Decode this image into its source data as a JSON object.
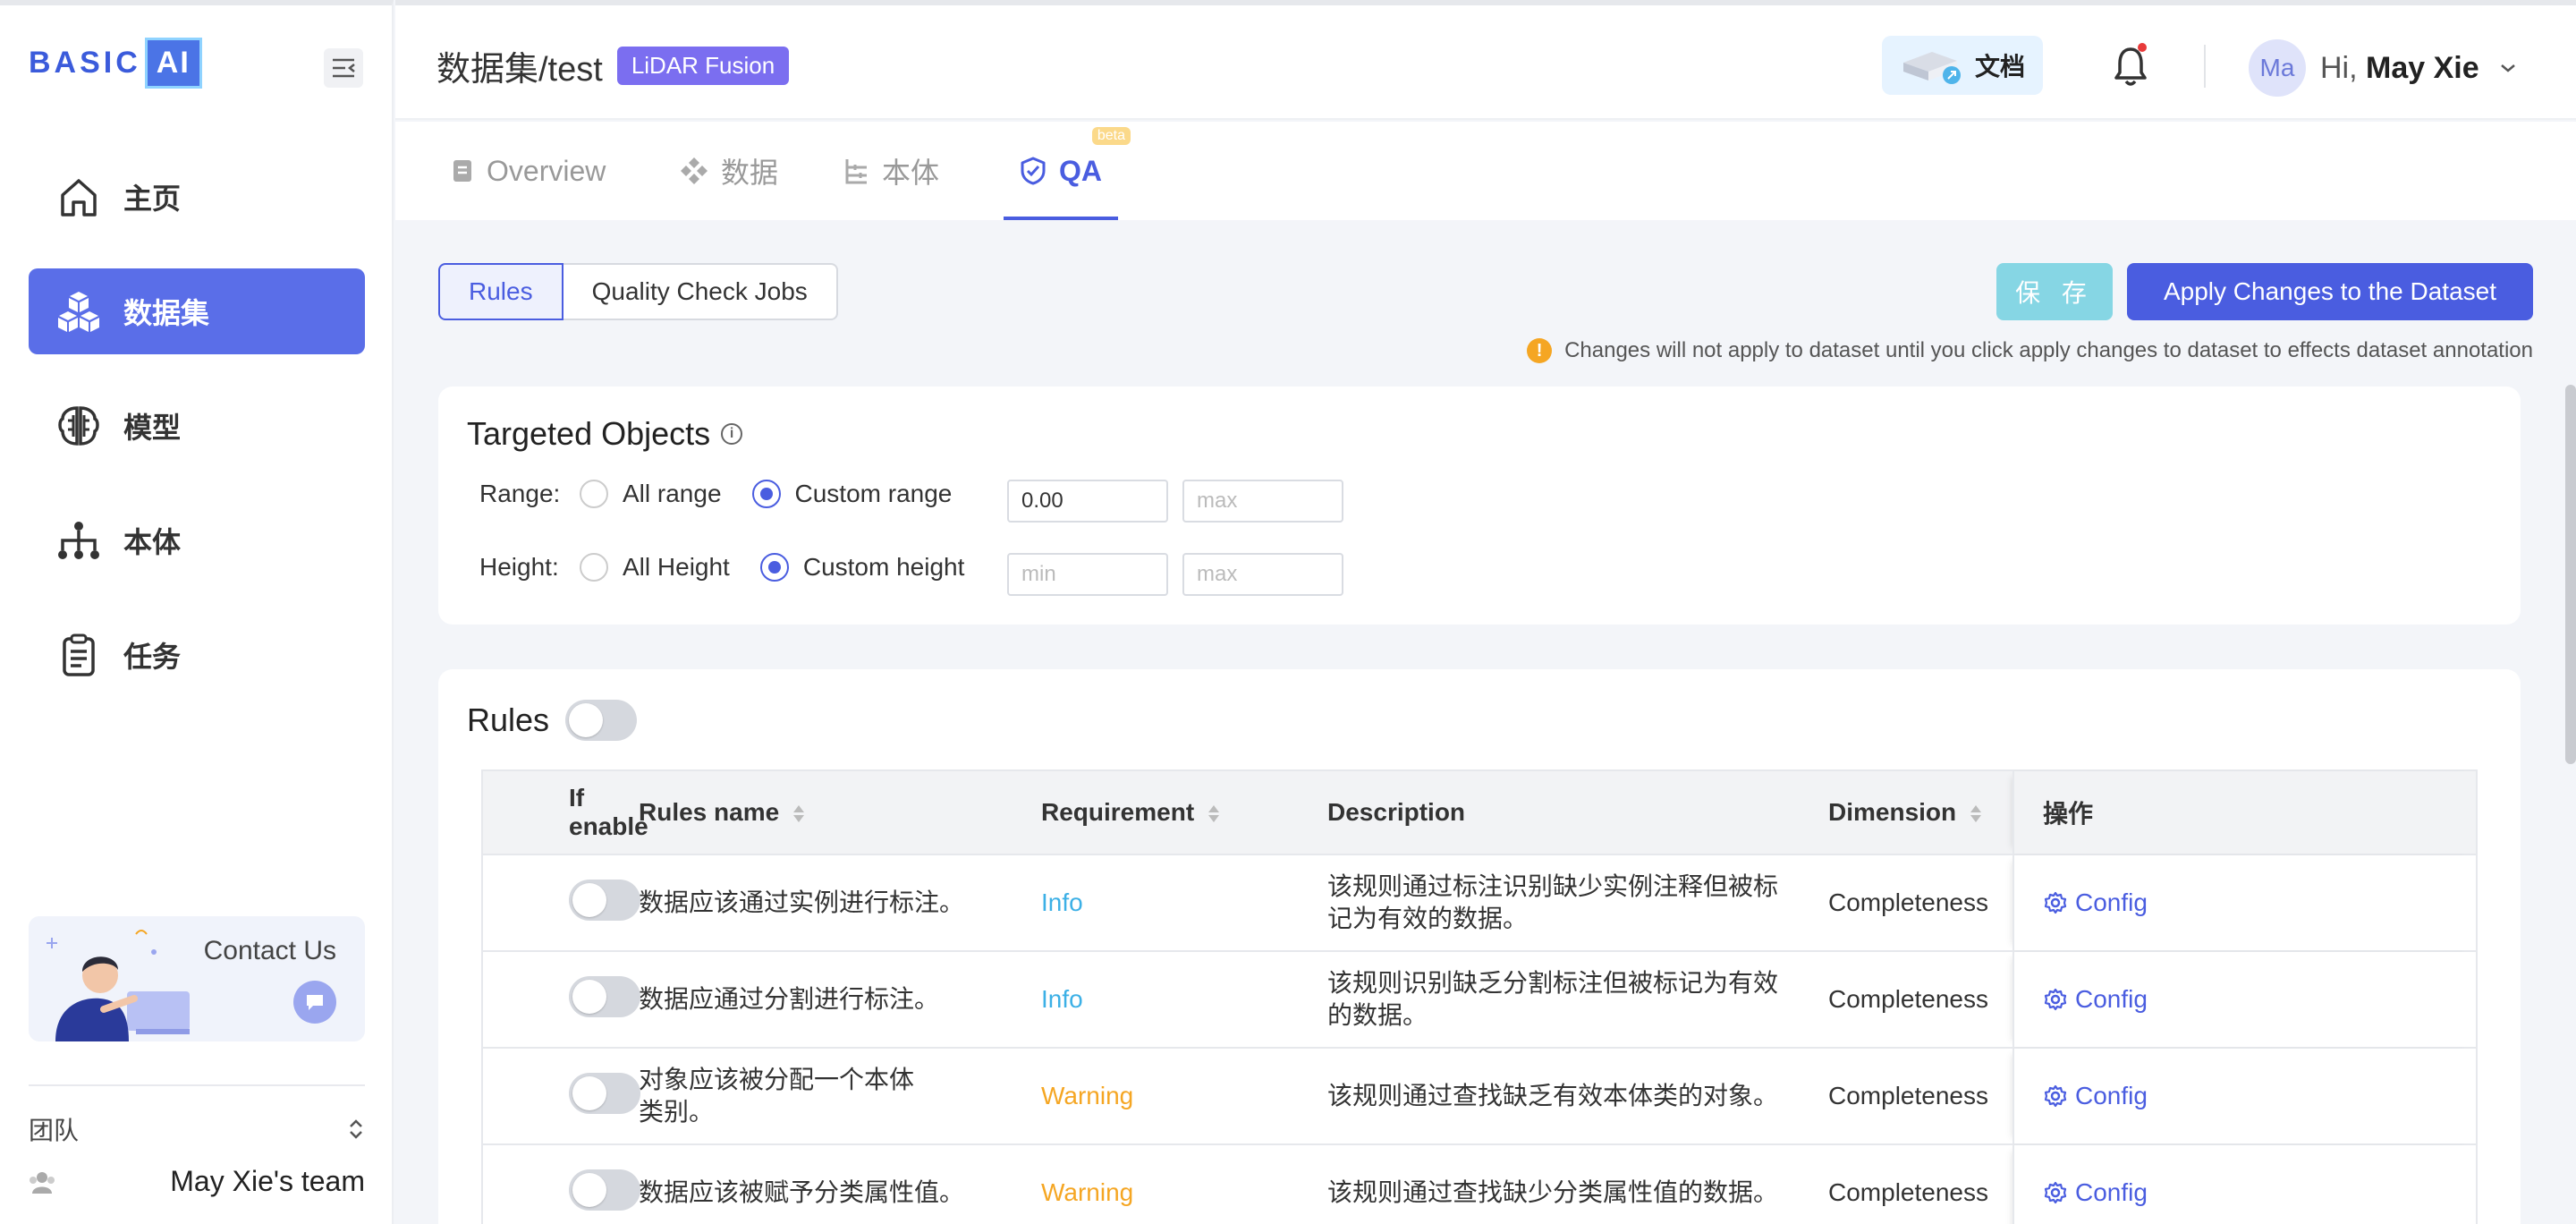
{
  "sidebar": {
    "logo_text": "BASIC",
    "logo_box": "AI",
    "items": [
      {
        "label": "主页",
        "icon": "home-icon",
        "active": false
      },
      {
        "label": "数据集",
        "icon": "cubes-icon",
        "active": true
      },
      {
        "label": "模型",
        "icon": "brain-icon",
        "active": false
      },
      {
        "label": "本体",
        "icon": "hierarchy-icon",
        "active": false
      },
      {
        "label": "任务",
        "icon": "clipboard-icon",
        "active": false
      }
    ],
    "contact_label": "Contact Us",
    "team_label": "团队",
    "team_name": "May Xie's team"
  },
  "header": {
    "breadcrumb": "数据集/test",
    "tag": "LiDAR Fusion",
    "docs_label": "文档",
    "avatar_initials": "Ma",
    "greeting": "Hi,",
    "user_name": "May Xie"
  },
  "tabs": [
    {
      "label": "Overview",
      "icon": "document-icon"
    },
    {
      "label": "数据",
      "icon": "diamonds-icon"
    },
    {
      "label": "本体",
      "icon": "tree-icon"
    },
    {
      "label": "QA",
      "icon": "shield-check-icon",
      "badge": "beta"
    }
  ],
  "toolbar": {
    "seg_rules": "Rules",
    "seg_jobs": "Quality Check Jobs",
    "save_label": "保 存",
    "apply_label": "Apply Changes to the Dataset",
    "notice": "Changes will not apply to dataset until you click apply changes to dataset to effects dataset annotation"
  },
  "targets": {
    "title": "Targeted Objects",
    "range_label": "Range:",
    "range_options": [
      "All range",
      "Custom range"
    ],
    "range_selected": "Custom range",
    "range_min_value": "0.00",
    "range_max_placeholder": "max",
    "height_label": "Height:",
    "height_options": [
      "All Height",
      "Custom height"
    ],
    "height_selected": "Custom height",
    "height_min_placeholder": "min",
    "height_max_placeholder": "max"
  },
  "rules": {
    "title": "Rules",
    "columns": {
      "enable": "If enable",
      "name": "Rules name",
      "requirement": "Requirement",
      "description": "Description",
      "dimension": "Dimension",
      "op": "操作"
    },
    "rows": [
      {
        "name": "数据应该通过实例进行标注。",
        "requirement": "Info",
        "req_level": "info",
        "description": "该规则通过标注识别缺少实例注释但被标记为有效的数据。",
        "dimension": "Completeness",
        "action": "Config"
      },
      {
        "name": "数据应通过分割进行标注。",
        "requirement": "Info",
        "req_level": "info",
        "description": "该规则识别缺乏分割标注但被标记为有效的数据。",
        "dimension": "Completeness",
        "action": "Config"
      },
      {
        "name": "对象应该被分配一个本体类别。",
        "requirement": "Warning",
        "req_level": "warning",
        "description": "该规则通过查找缺乏有效本体类的对象。",
        "dimension": "Completeness",
        "action": "Config"
      },
      {
        "name": "数据应该被赋予分类属性值。",
        "requirement": "Warning",
        "req_level": "warning",
        "description": "该规则通过查找缺少分类属性值的数据。",
        "dimension": "Completeness",
        "action": "Config"
      }
    ]
  },
  "colors": {
    "accent": "#4a5de0",
    "info": "#3cb0e6",
    "warning": "#f5a623",
    "save": "#86d6e4"
  }
}
